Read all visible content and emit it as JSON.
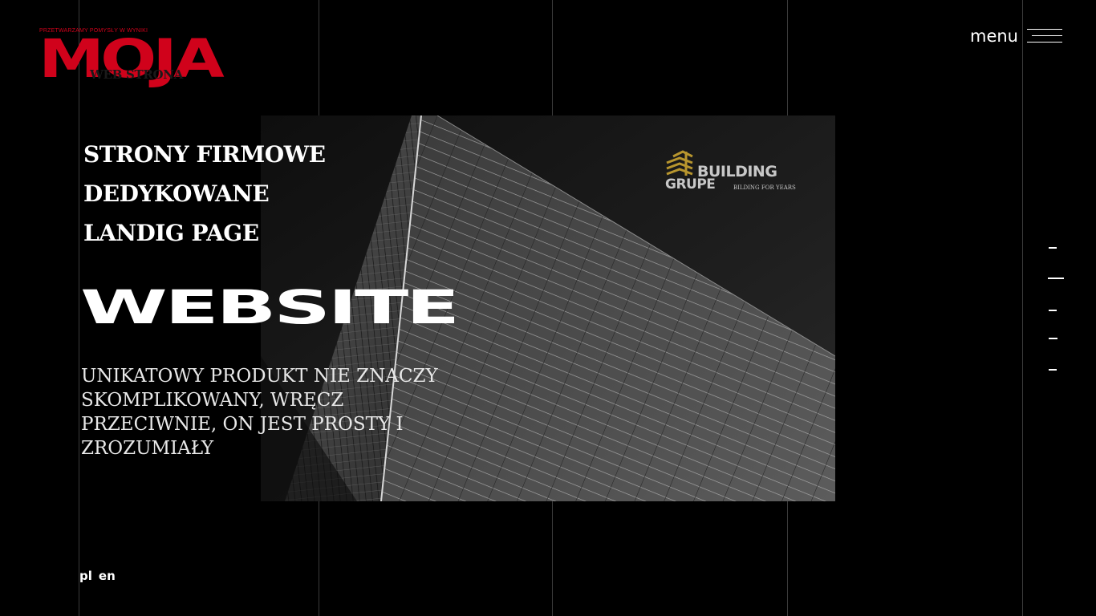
{
  "logo": {
    "tagline": "PRZETWARZAMY POMYSŁY W WYNIKI",
    "word": "MOJA",
    "sub": "WEB STRONA"
  },
  "menu": {
    "label": "menu",
    "icon": "hamburger-icon"
  },
  "services": [
    "STRONY FIRMOWE",
    "DEDYKOWANE",
    "LANDIG PAGE"
  ],
  "hero": {
    "title": "WEBSITE",
    "description": "UNIKATOWY PRODUKT NIE ZNACZY SKOMPLIKOWANY, WRĘCZ PRZECIWNIE, ON JEST PROSTY I ZROZUMIAŁY"
  },
  "client_logo": {
    "line1": "BUILDING",
    "line2": "GRUPE",
    "tagline": "BILDING FOR YEARS",
    "icon": "building-stack-icon"
  },
  "slide_nav": {
    "count": 5,
    "active_index": 1
  },
  "languages": [
    "pl",
    "en"
  ],
  "colors": {
    "brand_red": "#d0021b",
    "gold": "#b8962e",
    "background": "#000000"
  }
}
